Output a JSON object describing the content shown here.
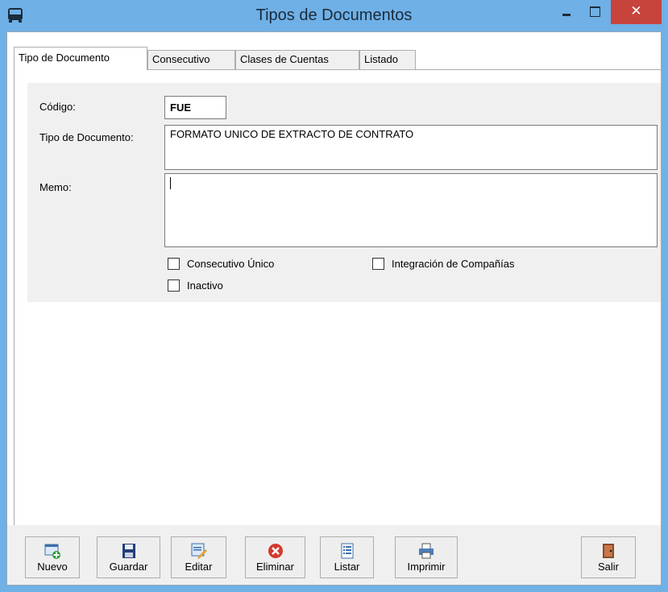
{
  "window": {
    "title": "Tipos de Documentos",
    "close_glyph": "✕"
  },
  "tabs": [
    {
      "label": "Tipo de Documento",
      "active": true
    },
    {
      "label": "Consecutivo",
      "active": false
    },
    {
      "label": "Clases de Cuentas",
      "active": false
    },
    {
      "label": "Listado",
      "active": false
    }
  ],
  "form": {
    "codigo_label": "Código:",
    "codigo_value": "FUE",
    "tipo_label": "Tipo de Documento:",
    "tipo_value": "FORMATO UNICO DE EXTRACTO DE CONTRATO",
    "memo_label": "Memo:",
    "memo_value": ""
  },
  "checkboxes": [
    {
      "label": "Consecutivo Único",
      "checked": false
    },
    {
      "label": "Integración de Compañías",
      "checked": false
    },
    {
      "label": "Inactivo",
      "checked": false
    }
  ],
  "toolbar": {
    "nuevo": "Nuevo",
    "guardar": "Guardar",
    "editar": "Editar",
    "eliminar": "Eliminar",
    "listar": "Listar",
    "imprimir": "Imprimir",
    "salir": "Salir"
  },
  "icons": {
    "app": "bus-icon",
    "nuevo": "new-document-icon",
    "guardar": "floppy-disk-icon",
    "editar": "edit-document-icon",
    "eliminar": "delete-icon",
    "listar": "list-icon",
    "imprimir": "printer-icon",
    "salir": "exit-door-icon"
  },
  "colors": {
    "titlebar": "#6fb0e6",
    "close_button": "#c7443c",
    "panel": "#f0f0f0"
  }
}
